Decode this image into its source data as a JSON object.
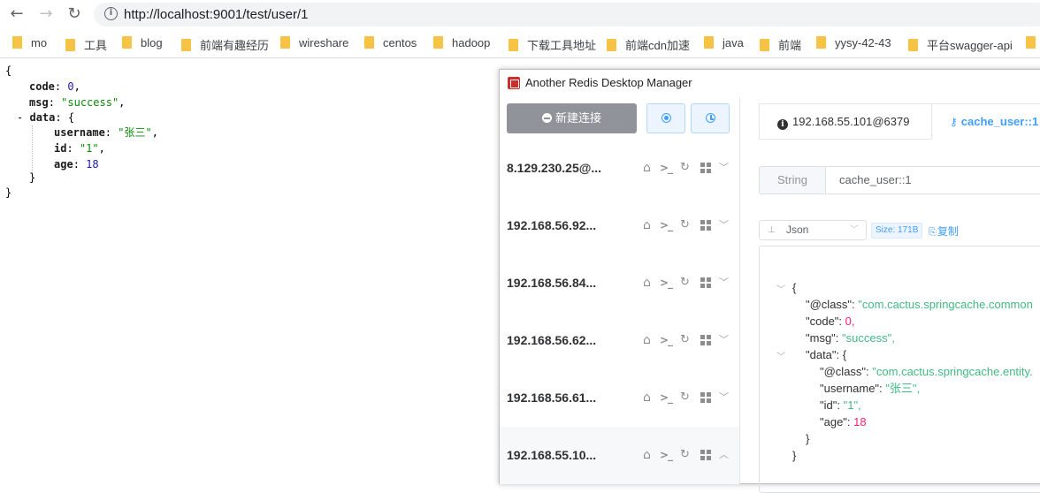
{
  "browser": {
    "url": "http://localhost:9001/test/user/1",
    "back_icon": "back-arrow-icon",
    "forward_icon": "forward-arrow-icon",
    "reload_icon": "reload-icon",
    "bookmarks": [
      "mo",
      "工具",
      "blog",
      "前端有趣经历",
      "wireshare",
      "centos",
      "hadoop",
      "下载工具地址",
      "前端cdn加速",
      "java",
      "前端",
      "yysy-42-43",
      "平台swagger-api"
    ]
  },
  "json_page": {
    "open_brace": "{",
    "code_key": "code",
    "code_val": "0",
    "msg_key": "msg",
    "msg_val": "\"success\"",
    "toggle": "-",
    "data_key": "data",
    "data_open": "{",
    "username_key": "username",
    "username_val": "\"张三\"",
    "id_key": "id",
    "id_val": "\"1\"",
    "age_key": "age",
    "age_val": "18",
    "data_close": "}",
    "close_brace": "}"
  },
  "rdm": {
    "title": "Another Redis Desktop Manager",
    "new_conn_label": "新建连接",
    "connections": [
      "8.129.230.25@...",
      "192.168.56.92...",
      "192.168.56.84...",
      "192.168.56.62...",
      "192.168.56.61...",
      "192.168.55.10..."
    ],
    "tabs": {
      "server": "192.168.55.101@6379",
      "key": "cache_user::1"
    },
    "key_type": "String",
    "key_name": "cache_user::1",
    "format": "Json",
    "size": "Size: 171B",
    "copy_label": "复制",
    "json": {
      "open": "{",
      "class_key": "\"@class\"",
      "class_val": "\"com.cactus.springcache.common",
      "code_key": "\"code\"",
      "code_val": "0,",
      "msg_key": "\"msg\"",
      "msg_val": "\"success\",",
      "data_key": "\"data\"",
      "data_open": "{",
      "dclass_key": "\"@class\"",
      "dclass_val": "\"com.cactus.springcache.entity.",
      "username_key": "\"username\"",
      "username_val": "\"张三\",",
      "id_key": "\"id\"",
      "id_val": "\"1\",",
      "age_key": "\"age\"",
      "age_val": "18",
      "data_close": "}",
      "close": "}"
    }
  }
}
